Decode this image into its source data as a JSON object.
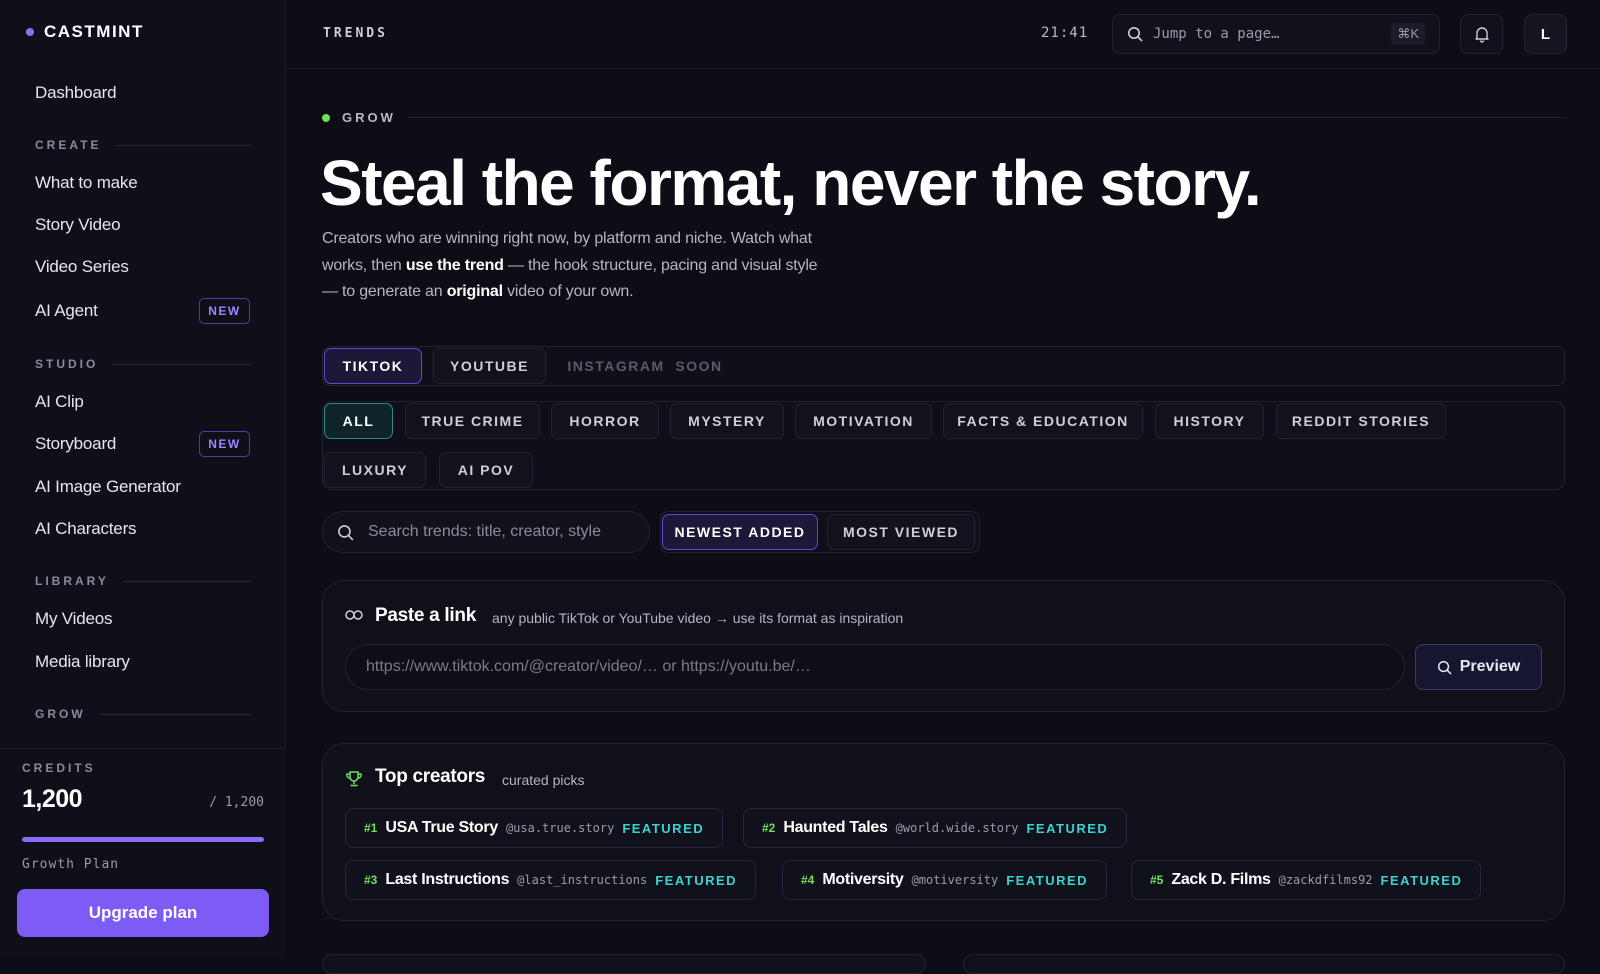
{
  "app": {
    "name": "CASTMINT"
  },
  "sidebar": {
    "top_item": "Dashboard",
    "sections": [
      {
        "title": "CREATE",
        "items": [
          {
            "label": "What to make"
          },
          {
            "label": "Story Video"
          },
          {
            "label": "Video Series"
          },
          {
            "label": "AI Agent",
            "badge": "NEW"
          }
        ]
      },
      {
        "title": "STUDIO",
        "items": [
          {
            "label": "AI Clip"
          },
          {
            "label": "Storyboard",
            "badge": "NEW"
          },
          {
            "label": "AI Image Generator"
          },
          {
            "label": "AI Characters"
          }
        ]
      },
      {
        "title": "LIBRARY",
        "items": [
          {
            "label": "My Videos"
          },
          {
            "label": "Media library"
          }
        ]
      },
      {
        "title": "GROW",
        "items": []
      }
    ],
    "credits": {
      "label": "CREDITS",
      "value": "1,200",
      "max": "/ 1,200",
      "fill": 1.0,
      "plan": "Growth Plan",
      "upgrade": "Upgrade plan"
    }
  },
  "topbar": {
    "title": "TRENDS",
    "clock": "21:41",
    "jump_placeholder": "Jump to a page…",
    "shortcut": "⌘K",
    "avatar": "L"
  },
  "hero": {
    "eyebrow": "GROW",
    "headline": "Steal the format, never the story.",
    "intro_1": "Creators who are winning right now, by platform and niche. Watch what works, then ",
    "intro_b1": "use the trend",
    "intro_2": " — the hook structure, pacing and visual style — to generate an ",
    "intro_b2": "original",
    "intro_3": " video of your own."
  },
  "platforms": [
    {
      "label": "TIKTOK",
      "state": "active"
    },
    {
      "label": "YOUTUBE",
      "state": "normal"
    },
    {
      "label": "INSTAGRAM  SOON",
      "state": "disabled"
    }
  ],
  "categories": [
    "ALL",
    "TRUE CRIME",
    "HORROR",
    "MYSTERY",
    "MOTIVATION",
    "FACTS & EDUCATION",
    "HISTORY",
    "REDDIT STORIES",
    "LUXURY",
    "AI POV"
  ],
  "search": {
    "placeholder": "Search trends: title, creator, style"
  },
  "sort": [
    "NEWEST ADDED",
    "MOST VIEWED"
  ],
  "paste_link": {
    "title": "Paste a link",
    "subtitle": "any public TikTok or YouTube video → use its format as inspiration",
    "placeholder": "https://www.tiktok.com/@creator/video/… or https://youtu.be/…",
    "button": "Preview"
  },
  "top_creators": {
    "title": "Top creators",
    "subtitle": "curated picks",
    "items": [
      {
        "rank": "#1",
        "name": "USA True Story",
        "handle": "@usa.true.story",
        "tag": "FEATURED"
      },
      {
        "rank": "#2",
        "name": "Haunted Tales",
        "handle": "@world.wide.story",
        "tag": "FEATURED"
      },
      {
        "rank": "#3",
        "name": "Last Instructions",
        "handle": "@last_instructions",
        "tag": "FEATURED"
      },
      {
        "rank": "#4",
        "name": "Motiversity",
        "handle": "@motiversity",
        "tag": "FEATURED"
      },
      {
        "rank": "#5",
        "name": "Zack D. Films",
        "handle": "@zackdfilms92",
        "tag": "FEATURED"
      }
    ]
  },
  "colors": {
    "accent": "#7c5cf4",
    "teal": "#38d4d4",
    "green": "#6ee05c",
    "bg": "#0d0d16"
  }
}
